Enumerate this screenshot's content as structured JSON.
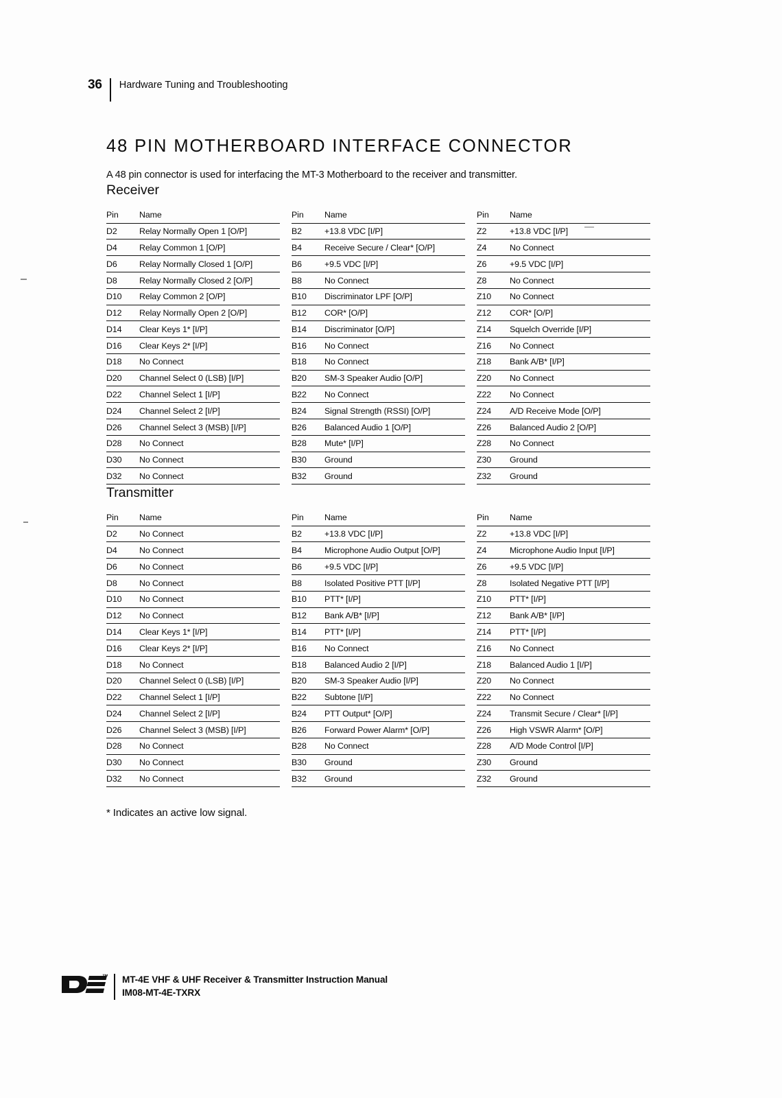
{
  "header": {
    "page_number": "36",
    "title": "Hardware Tuning and Troubleshooting"
  },
  "doc": {
    "title": "48 PIN MOTHERBOARD INTERFACE CONNECTOR",
    "intro": "A 48 pin connector is used for interfacing the MT-3 Motherboard to the receiver and transmitter.",
    "footnote": "* Indicates an active low signal."
  },
  "columns": {
    "pin": "Pin",
    "name": "Name"
  },
  "receiver": {
    "title": "Receiver",
    "tables": [
      {
        "rows": [
          {
            "pin": "D2",
            "name": "Relay Normally Open 1 [O/P]"
          },
          {
            "pin": "D4",
            "name": "Relay Common 1 [O/P]"
          },
          {
            "pin": "D6",
            "name": "Relay Normally Closed 1 [O/P]"
          },
          {
            "pin": "D8",
            "name": "Relay Normally Closed 2 [O/P]"
          },
          {
            "pin": "D10",
            "name": "Relay Common 2 [O/P]"
          },
          {
            "pin": "D12",
            "name": "Relay Normally Open 2 [O/P]"
          },
          {
            "pin": "D14",
            "name": "Clear Keys 1* [I/P]"
          },
          {
            "pin": "D16",
            "name": "Clear Keys 2* [I/P]"
          },
          {
            "pin": "D18",
            "name": "No Connect"
          },
          {
            "pin": "D20",
            "name": "Channel Select 0 (LSB) [I/P]"
          },
          {
            "pin": "D22",
            "name": "Channel Select 1 [I/P]"
          },
          {
            "pin": "D24",
            "name": "Channel Select 2 [I/P]"
          },
          {
            "pin": "D26",
            "name": "Channel Select 3 (MSB) [I/P]"
          },
          {
            "pin": "D28",
            "name": "No Connect"
          },
          {
            "pin": "D30",
            "name": "No Connect"
          },
          {
            "pin": "D32",
            "name": "No Connect"
          }
        ]
      },
      {
        "rows": [
          {
            "pin": "B2",
            "name": "+13.8 VDC [I/P]"
          },
          {
            "pin": "B4",
            "name": "Receive Secure / Clear* [O/P]"
          },
          {
            "pin": "B6",
            "name": "+9.5 VDC [I/P]"
          },
          {
            "pin": "B8",
            "name": "No Connect"
          },
          {
            "pin": "B10",
            "name": "Discriminator LPF [O/P]"
          },
          {
            "pin": "B12",
            "name": "COR* [O/P]"
          },
          {
            "pin": "B14",
            "name": "Discriminator [O/P]"
          },
          {
            "pin": "B16",
            "name": "No Connect"
          },
          {
            "pin": "B18",
            "name": "No Connect"
          },
          {
            "pin": "B20",
            "name": "SM-3 Speaker Audio [O/P]"
          },
          {
            "pin": "B22",
            "name": "No Connect"
          },
          {
            "pin": "B24",
            "name": "Signal Strength (RSSI) [O/P]"
          },
          {
            "pin": "B26",
            "name": "Balanced Audio 1 [O/P]"
          },
          {
            "pin": "B28",
            "name": "Mute* [I/P]"
          },
          {
            "pin": "B30",
            "name": "Ground"
          },
          {
            "pin": "B32",
            "name": "Ground"
          }
        ]
      },
      {
        "rows": [
          {
            "pin": "Z2",
            "name": "+13.8 VDC [I/P]"
          },
          {
            "pin": "Z4",
            "name": "No Connect"
          },
          {
            "pin": "Z6",
            "name": "+9.5 VDC [I/P]"
          },
          {
            "pin": "Z8",
            "name": "No Connect"
          },
          {
            "pin": "Z10",
            "name": "No Connect"
          },
          {
            "pin": "Z12",
            "name": "COR* [O/P]"
          },
          {
            "pin": "Z14",
            "name": "Squelch Override [I/P]"
          },
          {
            "pin": "Z16",
            "name": "No Connect"
          },
          {
            "pin": "Z18",
            "name": "Bank A/B* [I/P]"
          },
          {
            "pin": "Z20",
            "name": "No Connect"
          },
          {
            "pin": "Z22",
            "name": "No Connect"
          },
          {
            "pin": "Z24",
            "name": "A/D Receive Mode [O/P]"
          },
          {
            "pin": "Z26",
            "name": "Balanced Audio 2 [O/P]"
          },
          {
            "pin": "Z28",
            "name": "No Connect"
          },
          {
            "pin": "Z30",
            "name": "Ground"
          },
          {
            "pin": "Z32",
            "name": "Ground"
          }
        ]
      }
    ]
  },
  "transmitter": {
    "title": "Transmitter",
    "tables": [
      {
        "rows": [
          {
            "pin": "D2",
            "name": "No Connect"
          },
          {
            "pin": "D4",
            "name": "No Connect"
          },
          {
            "pin": "D6",
            "name": "No Connect"
          },
          {
            "pin": "D8",
            "name": "No Connect"
          },
          {
            "pin": "D10",
            "name": "No Connect"
          },
          {
            "pin": "D12",
            "name": "No Connect"
          },
          {
            "pin": "D14",
            "name": "Clear Keys 1* [I/P]"
          },
          {
            "pin": "D16",
            "name": "Clear Keys 2* [I/P]"
          },
          {
            "pin": "D18",
            "name": "No Connect"
          },
          {
            "pin": "D20",
            "name": "Channel Select 0 (LSB) [I/P]"
          },
          {
            "pin": "D22",
            "name": "Channel Select 1 [I/P]"
          },
          {
            "pin": "D24",
            "name": "Channel Select 2 [I/P]"
          },
          {
            "pin": "D26",
            "name": "Channel Select 3 (MSB) [I/P]"
          },
          {
            "pin": "D28",
            "name": "No Connect"
          },
          {
            "pin": "D30",
            "name": "No Connect"
          },
          {
            "pin": "D32",
            "name": "No Connect"
          }
        ]
      },
      {
        "rows": [
          {
            "pin": "B2",
            "name": "+13.8 VDC [I/P]"
          },
          {
            "pin": "B4",
            "name": "Microphone Audio Output [O/P]"
          },
          {
            "pin": "B6",
            "name": "+9.5 VDC [I/P]"
          },
          {
            "pin": "B8",
            "name": "Isolated Positive PTT [I/P]"
          },
          {
            "pin": "B10",
            "name": "PTT* [I/P]"
          },
          {
            "pin": "B12",
            "name": "Bank A/B* [I/P]"
          },
          {
            "pin": "B14",
            "name": "PTT* [I/P]"
          },
          {
            "pin": "B16",
            "name": "No Connect"
          },
          {
            "pin": "B18",
            "name": "Balanced Audio 2 [I/P]"
          },
          {
            "pin": "B20",
            "name": "SM-3 Speaker Audio [I/P]"
          },
          {
            "pin": "B22",
            "name": "Subtone [I/P]"
          },
          {
            "pin": "B24",
            "name": "PTT Output* [O/P]"
          },
          {
            "pin": "B26",
            "name": "Forward Power Alarm* [O/P]"
          },
          {
            "pin": "B28",
            "name": "No Connect"
          },
          {
            "pin": "B30",
            "name": "Ground"
          },
          {
            "pin": "B32",
            "name": "Ground"
          }
        ]
      },
      {
        "rows": [
          {
            "pin": "Z2",
            "name": "+13.8 VDC [I/P]"
          },
          {
            "pin": "Z4",
            "name": "Microphone Audio Input [I/P]"
          },
          {
            "pin": "Z6",
            "name": "+9.5 VDC [I/P]"
          },
          {
            "pin": "Z8",
            "name": "Isolated Negative PTT [I/P]"
          },
          {
            "pin": "Z10",
            "name": "PTT* [I/P]"
          },
          {
            "pin": "Z12",
            "name": "Bank A/B* [I/P]"
          },
          {
            "pin": "Z14",
            "name": "PTT* [I/P]"
          },
          {
            "pin": "Z16",
            "name": "No Connect"
          },
          {
            "pin": "Z18",
            "name": "Balanced Audio 1 [I/P]"
          },
          {
            "pin": "Z20",
            "name": "No Connect"
          },
          {
            "pin": "Z22",
            "name": "No Connect"
          },
          {
            "pin": "Z24",
            "name": "Transmit Secure / Clear* [I/P]"
          },
          {
            "pin": "Z26",
            "name": "High VSWR Alarm* [O/P]"
          },
          {
            "pin": "Z28",
            "name": "A/D Mode Control [I/P]"
          },
          {
            "pin": "Z30",
            "name": "Ground"
          },
          {
            "pin": "Z32",
            "name": "Ground"
          }
        ]
      }
    ]
  },
  "footer": {
    "logo_tm": "™",
    "manual_title": "MT-4E VHF & UHF Receiver & Transmitter Instruction Manual",
    "manual_code": "IM08-MT-4E-TXRX"
  }
}
